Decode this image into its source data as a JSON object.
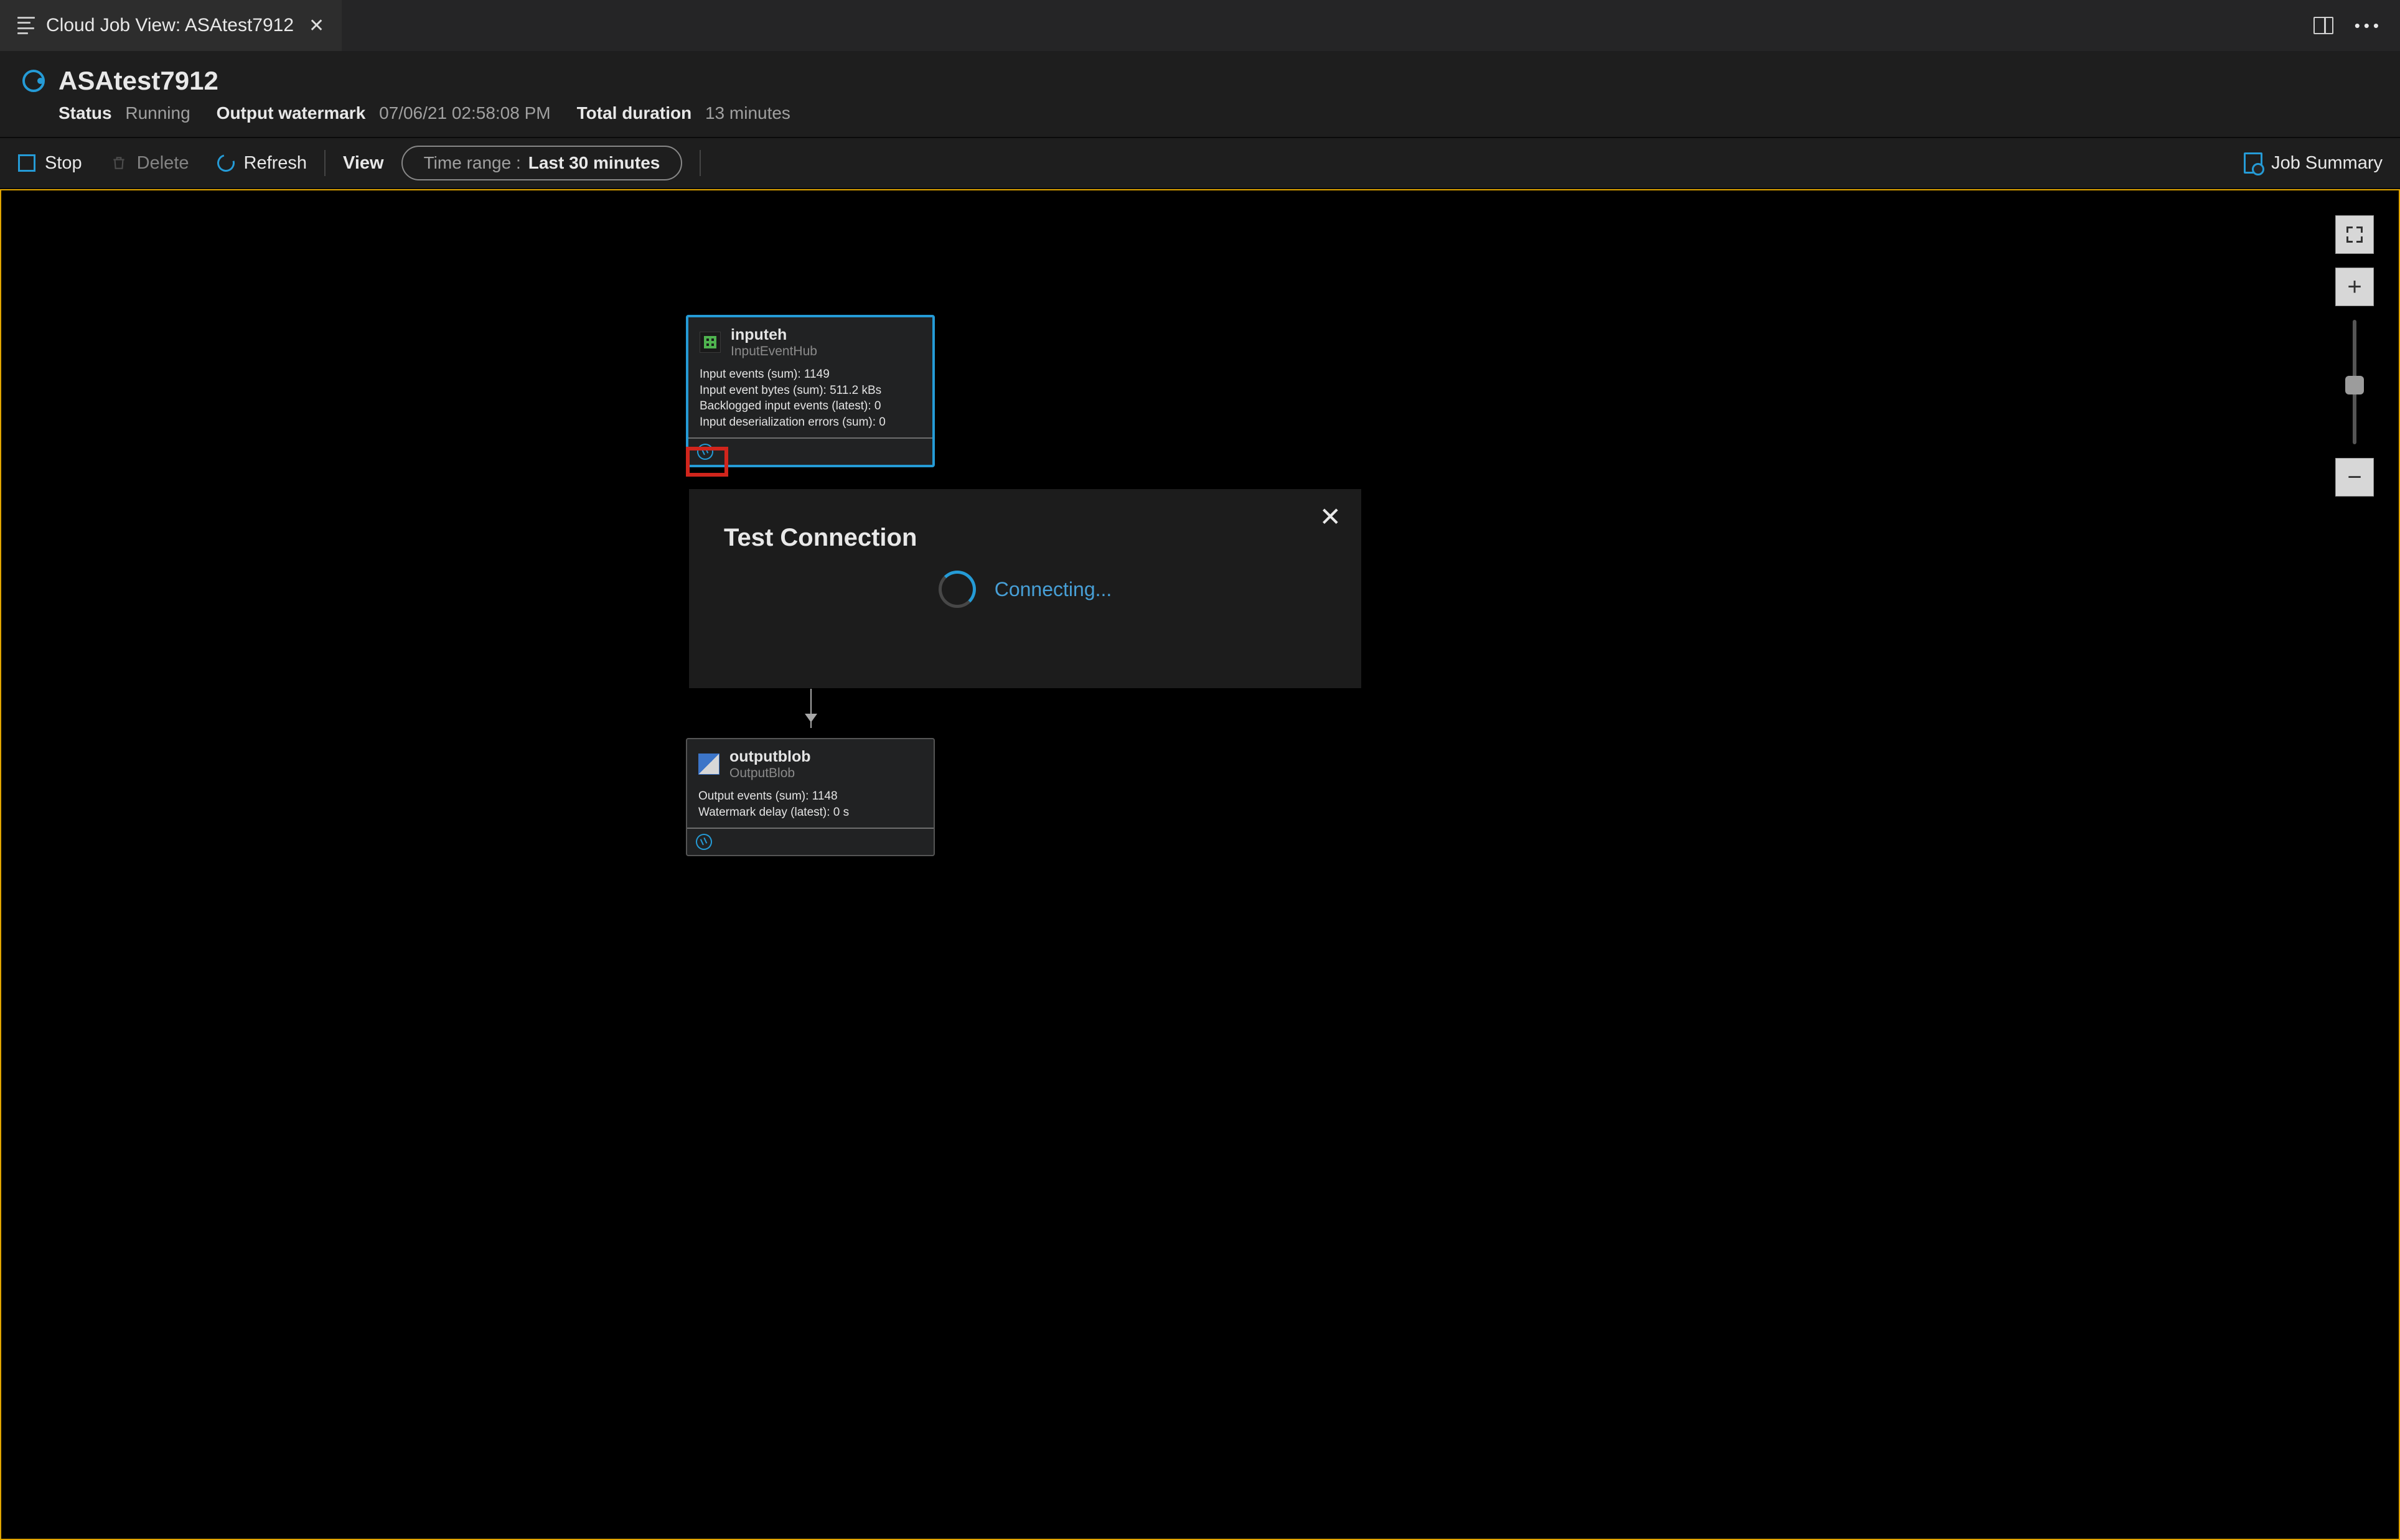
{
  "tab": {
    "title": "Cloud Job View: ASAtest7912"
  },
  "header": {
    "jobName": "ASAtest7912",
    "status": {
      "label": "Status",
      "value": "Running"
    },
    "watermark": {
      "label": "Output watermark",
      "value": "07/06/21 02:58:08 PM"
    },
    "duration": {
      "label": "Total duration",
      "value": "13 minutes"
    }
  },
  "toolbar": {
    "stop": "Stop",
    "delete": "Delete",
    "refresh": "Refresh",
    "view": "View",
    "timeRangeLabel": "Time range :",
    "timeRangeValue": "Last 30 minutes",
    "jobSummary": "Job Summary"
  },
  "nodes": {
    "input": {
      "name": "inputeh",
      "type": "InputEventHub",
      "metrics": [
        "Input events (sum): 1149",
        "Input event bytes (sum): 511.2 kBs",
        "Backlogged input events (latest): 0",
        "Input deserialization errors (sum): 0"
      ]
    },
    "output": {
      "name": "outputblob",
      "type": "OutputBlob",
      "metrics": [
        "Output events (sum): 1148",
        "Watermark delay (latest): 0 s"
      ]
    }
  },
  "dialog": {
    "title": "Test Connection",
    "status": "Connecting..."
  }
}
